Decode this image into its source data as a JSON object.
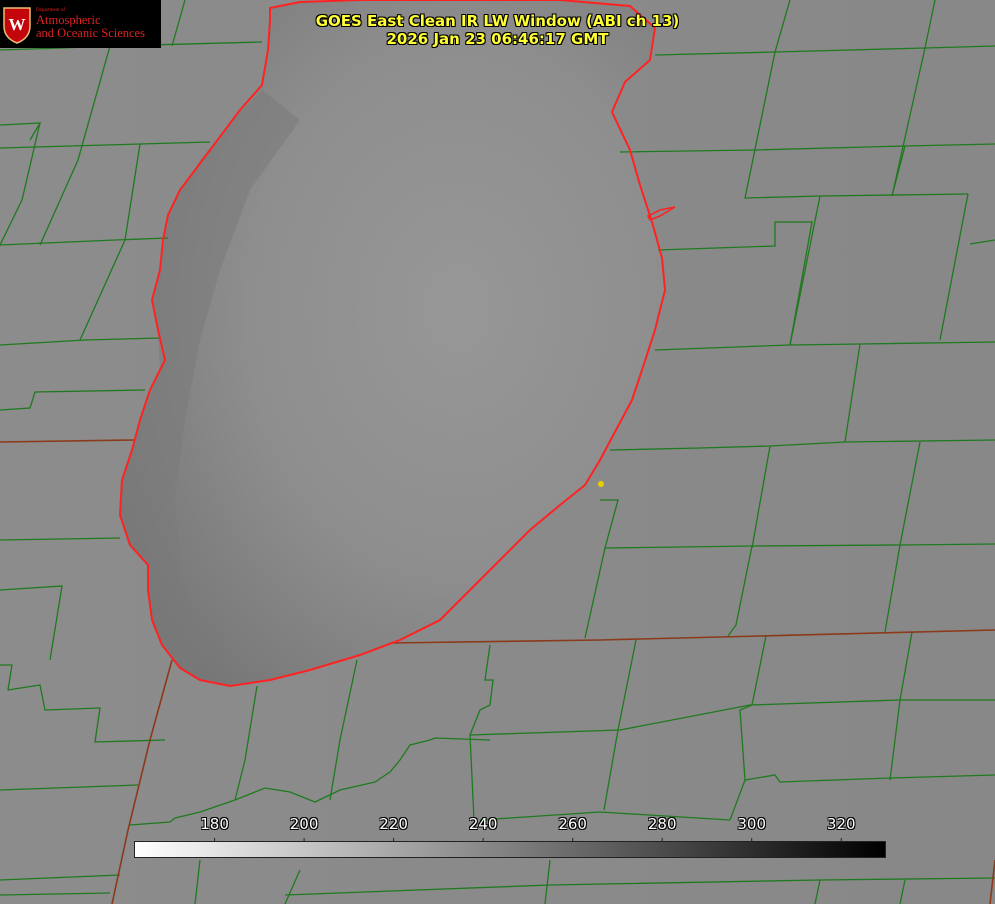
{
  "logo": {
    "department": "Department of",
    "line1": "Atmospheric",
    "line2": "and Oceanic Sciences",
    "crest_icon": "uw-crest-icon",
    "colors": {
      "background": "#000000",
      "text": "#dd2222",
      "crest": "#c5050c"
    }
  },
  "title": {
    "line1": "GOES East Clean IR LW Window (ABI ch 13)",
    "line2": "2026 Jan 23 06:46:17 GMT",
    "color": "#ffff33"
  },
  "colorbar": {
    "min": 162,
    "max": 330,
    "ticks": [
      {
        "label": "180",
        "value": 180
      },
      {
        "label": "200",
        "value": 200
      },
      {
        "label": "220",
        "value": 220
      },
      {
        "label": "240",
        "value": 240
      },
      {
        "label": "260",
        "value": 260
      },
      {
        "label": "280",
        "value": 280
      },
      {
        "label": "300",
        "value": 300
      },
      {
        "label": "320",
        "value": 320
      }
    ],
    "color_low": "#ffffff",
    "color_high": "#000000"
  },
  "map_colors": {
    "land": "#8a8a8a",
    "lake": "#8f8f8f",
    "county_lines": "#1f7a1f",
    "state_lines": "#8b3a1a",
    "coastline": "#ff2222",
    "marker": "#e8d000"
  }
}
